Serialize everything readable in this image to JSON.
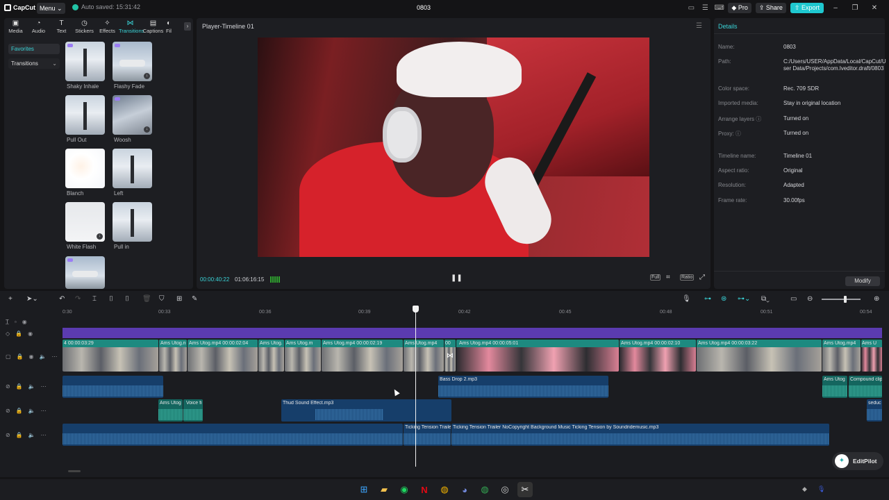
{
  "app": {
    "logo": "CapCut",
    "menu_label": "Menu",
    "autosave": "Auto saved: 15:31:42",
    "title": "0803",
    "pro_label": "Pro",
    "share_label": "Share",
    "export_label": "Export",
    "accent": "#3ad4d8"
  },
  "tools": [
    {
      "label": "Media",
      "icon": "media-icon"
    },
    {
      "label": "Audio",
      "icon": "audio-icon"
    },
    {
      "label": "Text",
      "icon": "text-icon"
    },
    {
      "label": "Stickers",
      "icon": "stickers-icon"
    },
    {
      "label": "Effects",
      "icon": "effects-icon"
    },
    {
      "label": "Transitions",
      "icon": "transitions-icon",
      "active": true
    },
    {
      "label": "Captions",
      "icon": "captions-icon"
    },
    {
      "label": "Fil",
      "icon": "filters-icon"
    }
  ],
  "sidebar": {
    "favorites": "Favorites",
    "transitions": "Transitions"
  },
  "transitions": [
    {
      "label": "Shaky Inhale"
    },
    {
      "label": "Flashy Fade"
    },
    {
      "label": "Pull Out"
    },
    {
      "label": "Woosh"
    },
    {
      "label": "Blanch"
    },
    {
      "label": "Left"
    },
    {
      "label": "White Flash"
    },
    {
      "label": "Pull in"
    }
  ],
  "player": {
    "title": "Player-Timeline 01",
    "current_time": "00:00:40:22",
    "total_time": "01:06:16:15",
    "full_label": "Full",
    "ratio_label": "Ratio"
  },
  "details": {
    "heading": "Details",
    "rows": [
      {
        "label": "Name:",
        "value": "0803"
      },
      {
        "label": "Path:",
        "value": "C:/Users/USER/AppData/Local/CapCut/User Data/Projects/com.lveditor.draft/0803"
      },
      {
        "label": "Color space:",
        "value": "Rec. 709 SDR"
      },
      {
        "label": "Imported media:",
        "value": "Stay in original location"
      },
      {
        "label": "Arrange layers",
        "value": "Turned on"
      },
      {
        "label": "Proxy:",
        "value": "Turned on"
      },
      {
        "label": "Timeline name:",
        "value": "Timeline 01"
      },
      {
        "label": "Aspect ratio:",
        "value": "Original"
      },
      {
        "label": "Resolution:",
        "value": "Adapted"
      },
      {
        "label": "Frame rate:",
        "value": "30.00fps"
      }
    ],
    "modify_label": "Modify"
  },
  "timeline": {
    "ruler": [
      "0:30",
      "00:33",
      "00:36",
      "00:39",
      "00:42",
      "00:45",
      "00:48",
      "00:51",
      "00:54"
    ],
    "video_clips": [
      {
        "label": "4   00:00:03:29"
      },
      {
        "label": "Ams Utog.n"
      },
      {
        "label": "Ams Utog.mp4  00:00:02:04"
      },
      {
        "label": "Ams Utog."
      },
      {
        "label": "Ams Utog.m"
      },
      {
        "label": "Ams Utog.mp4  00:00:02:19"
      },
      {
        "label": "Ams Utog.mp4"
      },
      {
        "label": "00"
      },
      {
        "label": "Ams Utog.mp4  00:00:05:01"
      },
      {
        "label": "Ams Utog.mp4  00:00:02:10"
      },
      {
        "label": "Ams Utog.mp4  00:00:03:22"
      },
      {
        "label": "Ams Utog.mp4"
      },
      {
        "label": "Ams U"
      }
    ],
    "audio_clips": [
      {
        "label": "Bass Drop 2.mp3"
      },
      {
        "label": "Ams Utog"
      },
      {
        "label": "Compound clip"
      },
      {
        "label": "Ams Utog"
      },
      {
        "label": "Voice fi"
      },
      {
        "label": "Thud Sound Effect.mp3"
      },
      {
        "label": "seduc"
      },
      {
        "label": "Ticking Tension Traile"
      },
      {
        "label": "Ticking Tension Trailer NoCopyright Background Music  Ticking Tension by Soundridemusic.mp3"
      }
    ],
    "editpilot_label": "EditPilot"
  }
}
